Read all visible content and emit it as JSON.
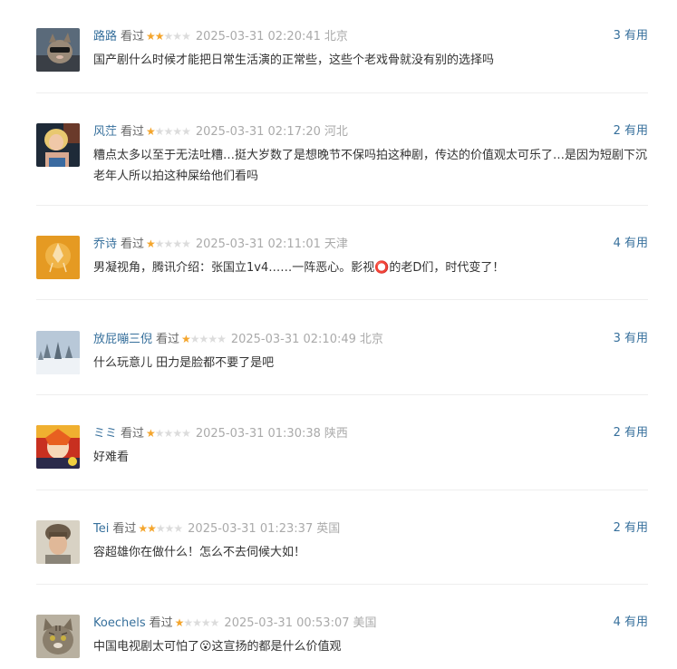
{
  "comments": [
    {
      "user": "路路",
      "status": "看过",
      "rating": 2,
      "time": "2025-03-31 02:20:41",
      "location": "北京",
      "votes": "3",
      "useful_label": "有用",
      "content": "国产剧什么时候才能把日常生活演的正常些，这些个老戏骨就没有别的选择吗",
      "avatar": "cat-with-sunglasses"
    },
    {
      "user": "风茳",
      "status": "看过",
      "rating": 1,
      "time": "2025-03-31 02:17:20",
      "location": "河北",
      "votes": "2",
      "useful_label": "有用",
      "content": "糟点太多以至于无法吐糟…挺大岁数了是想晚节不保吗拍这种剧，传达的价值观太可乐了…是因为短剧下沉老年人所以拍这种屎给他们看吗",
      "avatar": "blonde-woman-portrait"
    },
    {
      "user": "乔诗",
      "status": "看过",
      "rating": 1,
      "time": "2025-03-31 02:11:01",
      "location": "天津",
      "votes": "4",
      "useful_label": "有用",
      "content": "男凝视角，腾讯介绍：张国立1v4……一阵恶心。影视⭕的老D们，时代变了！",
      "avatar": "orange-light-figure"
    },
    {
      "user": "放屁嘣三倪",
      "status": "看过",
      "rating": 1,
      "time": "2025-03-31 02:10:49",
      "location": "北京",
      "votes": "3",
      "useful_label": "有用",
      "content": "什么玩意儿 田力是脸都不要了是吧",
      "avatar": "snowy-forest"
    },
    {
      "user": "ミミ",
      "status": "看过",
      "rating": 1,
      "time": "2025-03-31 01:30:38",
      "location": "陕西",
      "votes": "2",
      "useful_label": "有用",
      "content": "好难看",
      "avatar": "anime-character"
    },
    {
      "user": "Tei",
      "status": "看过",
      "rating": 2,
      "time": "2025-03-31 01:23:37",
      "location": "英国",
      "votes": "2",
      "useful_label": "有用",
      "content": "容超雄你在做什么！怎么不去伺候大如！",
      "avatar": "person-in-knit-hat"
    },
    {
      "user": "Koechels",
      "status": "看过",
      "rating": 1,
      "time": "2025-03-31 00:53:07",
      "location": "美国",
      "votes": "4",
      "useful_label": "有用",
      "content": "中国电视剧太可怕了😮这宣扬的都是什么价值观",
      "avatar": "tabby-cat"
    }
  ],
  "colors": {
    "link": "#37709c",
    "star_on": "#f4a52c",
    "star_off": "#dcdcdc",
    "muted": "#aaaaaa",
    "text": "#333333"
  }
}
